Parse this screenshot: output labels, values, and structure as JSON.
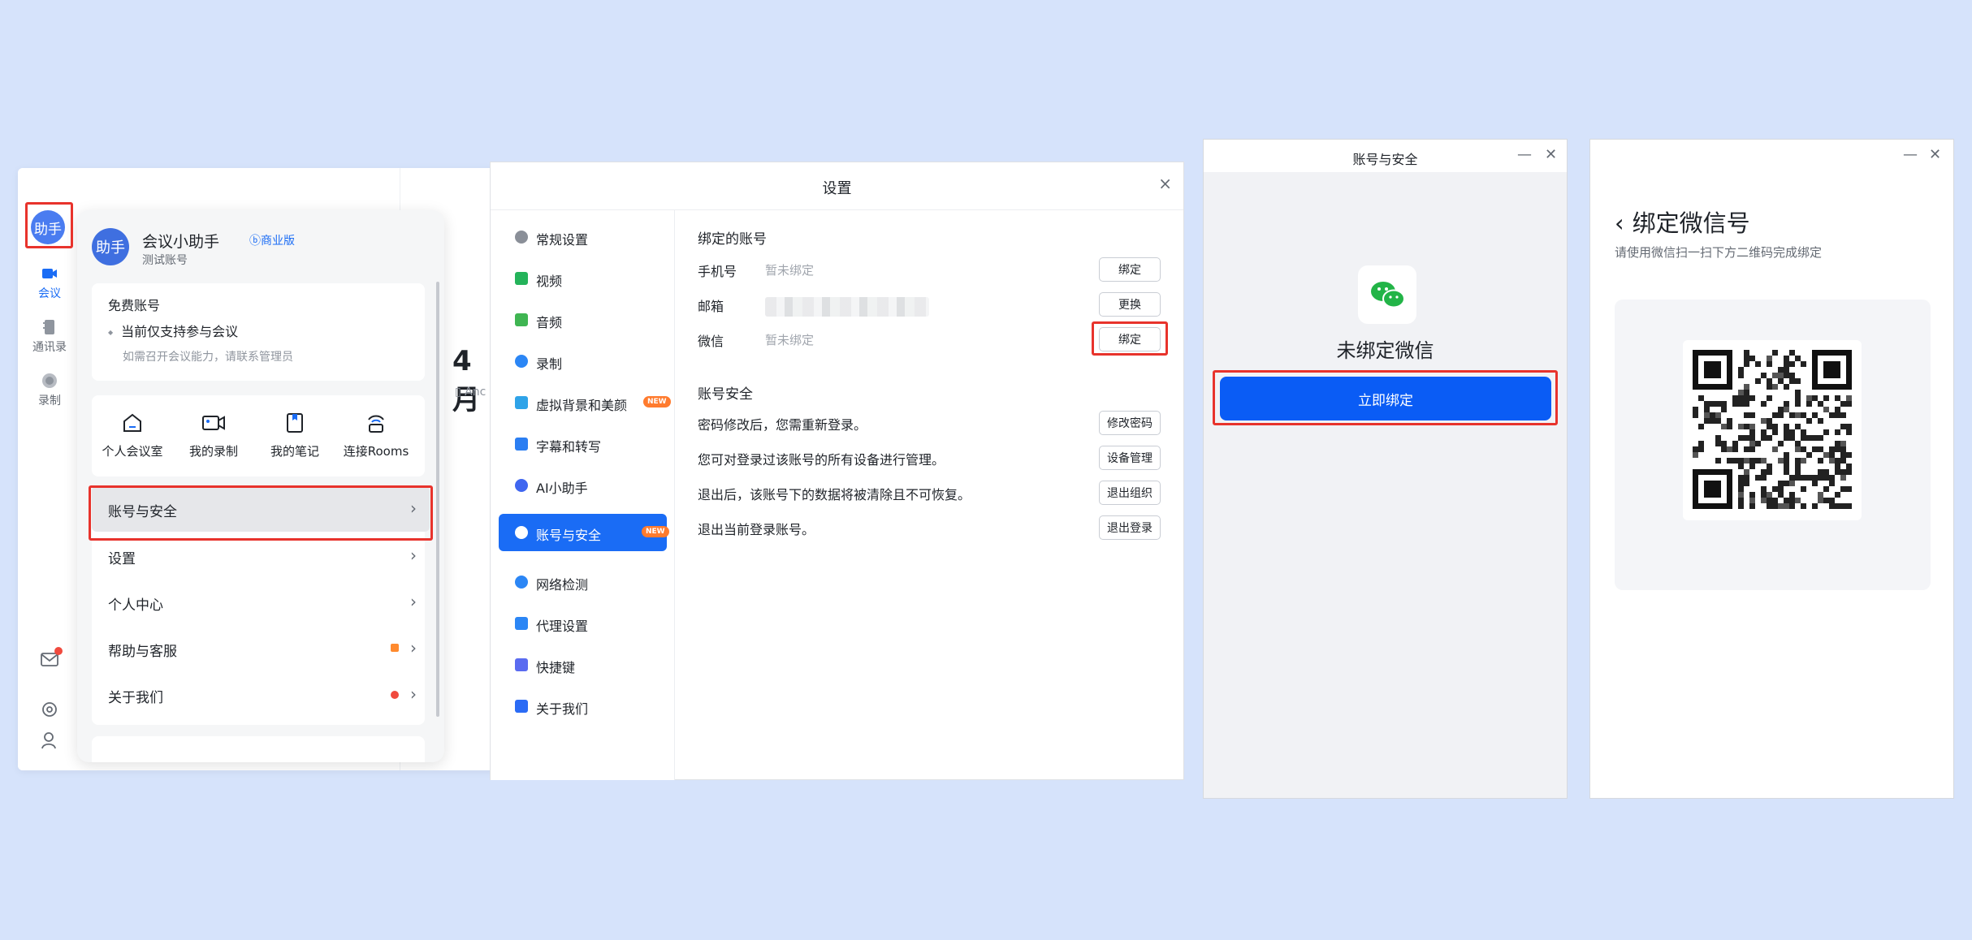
{
  "app": {
    "avatar_text": "助手",
    "nav": {
      "meeting": "会议",
      "contacts": "通讯录",
      "record": "录制"
    },
    "date_title": "4月",
    "date_sub": "Anc",
    "menu": {
      "name": "会议小助手",
      "badge": "商业版",
      "sub": "测试账号",
      "free_title": "免费账号",
      "free_line": "当前仅支持参与会议",
      "free_hint": "如需召开会议能力，请联系管理员",
      "quick": [
        "个人会议室",
        "我的录制",
        "我的笔记",
        "连接Rooms"
      ],
      "rows": [
        "账号与安全",
        "设置",
        "个人中心",
        "帮助与客服",
        "关于我们"
      ]
    }
  },
  "settings": {
    "title": "设置",
    "close": "×",
    "sidebar": [
      {
        "label": "常规设置",
        "color": "#8a8f98"
      },
      {
        "label": "视频",
        "color": "#24b35a"
      },
      {
        "label": "音频",
        "color": "#3fb552"
      },
      {
        "label": "录制",
        "color": "#2b86f5"
      },
      {
        "label": "虚拟背景和美颜",
        "color": "#2fa3e8",
        "new": "NEW"
      },
      {
        "label": "字幕和转写",
        "color": "#2b7ef2"
      },
      {
        "label": "AI小助手",
        "color": "#3f66f0"
      },
      {
        "label": "账号与安全",
        "color": "#ffffff",
        "new": "NEW",
        "active": true
      },
      {
        "label": "网络检测",
        "color": "#2b86f5"
      },
      {
        "label": "代理设置",
        "color": "#2b86f5"
      },
      {
        "label": "快捷键",
        "color": "#5a6bf0"
      },
      {
        "label": "关于我们",
        "color": "#2b6bf5"
      }
    ],
    "bound_title": "绑定的账号",
    "accounts": [
      {
        "label": "手机号",
        "value": "暂未绑定",
        "btn": "绑定"
      },
      {
        "label": "邮箱",
        "value": "",
        "btn": "更换"
      },
      {
        "label": "微信",
        "value": "暂未绑定",
        "btn": "绑定"
      }
    ],
    "security_title": "账号安全",
    "security": [
      {
        "text": "密码修改后，您需重新登录。",
        "btn": "修改密码"
      },
      {
        "text": "您可对登录过该账号的所有设备进行管理。",
        "btn": "设备管理"
      },
      {
        "text": "退出后，该账号下的数据将被清除且不可恢复。",
        "btn": "退出组织"
      },
      {
        "text": "退出当前登录账号。",
        "btn": "退出登录"
      }
    ]
  },
  "win3": {
    "title": "账号与安全",
    "minimize": "—",
    "close": "✕",
    "status": "未绑定微信",
    "bind_button": "立即绑定"
  },
  "win4": {
    "minimize": "—",
    "close": "✕",
    "title": "绑定微信号",
    "back": "‹",
    "subtitle": "请使用微信扫一扫下方二维码完成绑定"
  }
}
